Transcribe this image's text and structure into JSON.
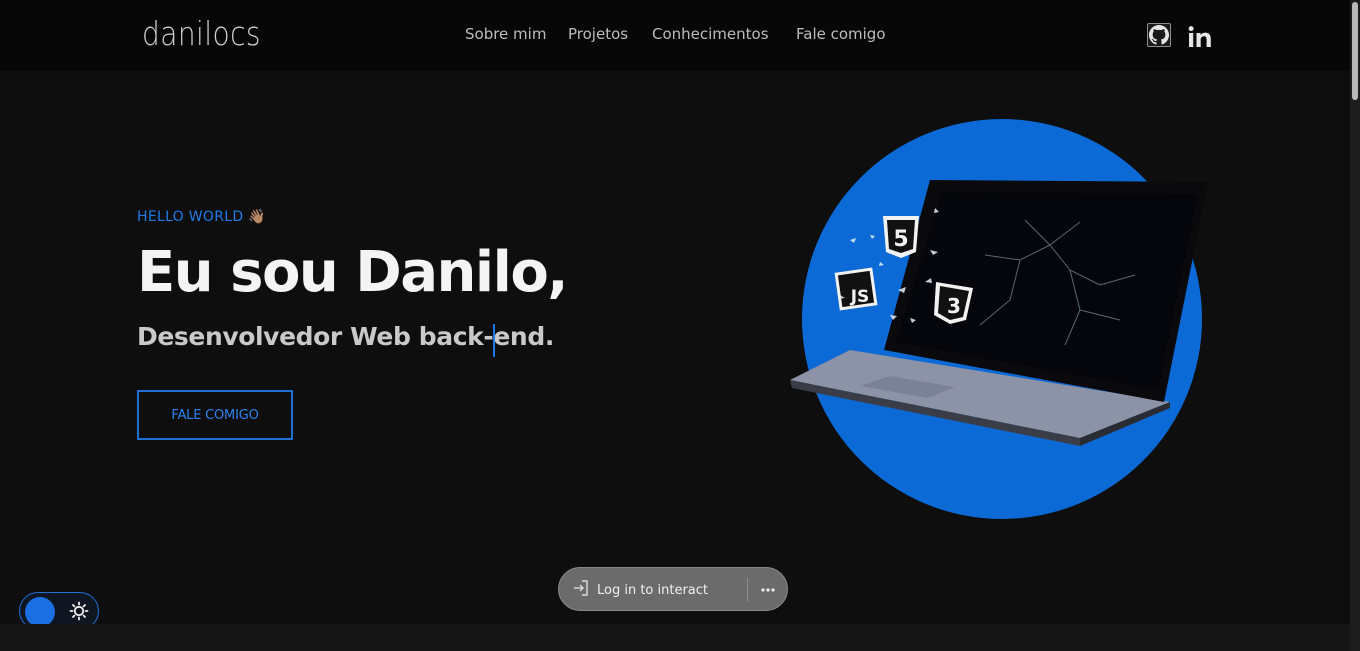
{
  "brand": {
    "logo": "danilocs"
  },
  "nav": {
    "items": [
      {
        "label": "Sobre mim"
      },
      {
        "label": "Projetos"
      },
      {
        "label": "Conhecimentos"
      },
      {
        "label": "Fale comigo"
      }
    ]
  },
  "social": {
    "github_icon": "github-icon",
    "linkedin_icon": "linkedin-icon"
  },
  "hero": {
    "greeting": "HELLO WORLD 👋🏽",
    "headline": "Eu sou Danilo,",
    "subline": "Desenvolvedor Web back-end.",
    "cta_label": "FALE COMIGO"
  },
  "illustration": {
    "badges": [
      "5",
      "JS",
      "3"
    ]
  },
  "login_pill": {
    "label": "Log in to interact",
    "icon": "login-icon",
    "more_icon": "more-icon"
  },
  "theme_toggle": {
    "icon": "sun-icon"
  },
  "colors": {
    "accent": "#1f7ae6",
    "background": "#0e0e0e",
    "header": "#070707",
    "circle": "#0b6ad6"
  }
}
